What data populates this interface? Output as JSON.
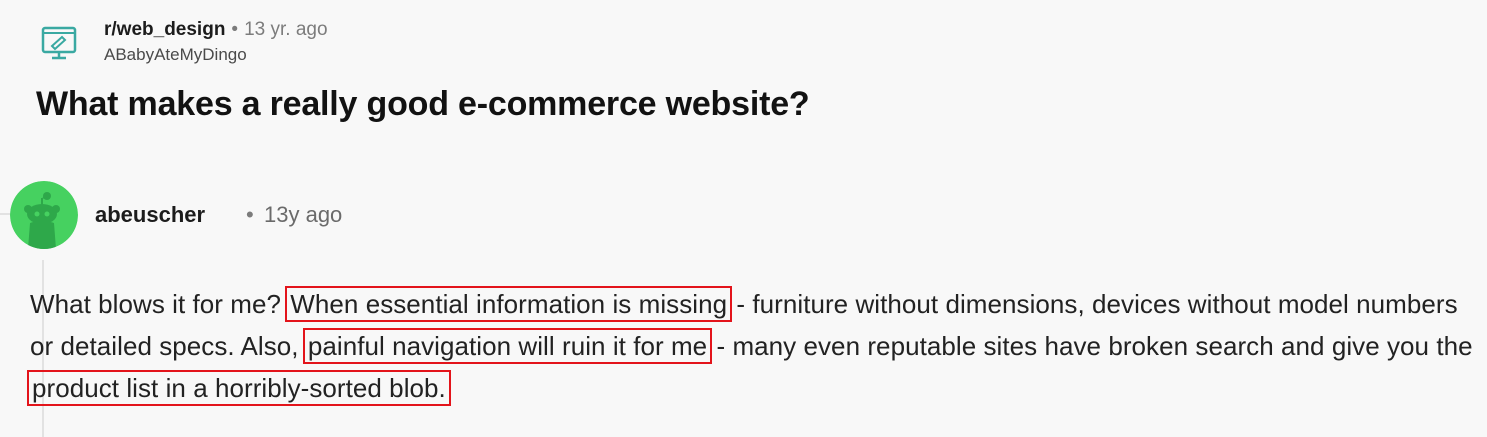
{
  "post": {
    "subreddit": "r/web_design",
    "separator": "•",
    "age": "13 yr. ago",
    "author": "ABabyAteMyDingo",
    "title": "What makes a really good e-commerce website?",
    "subreddit_icon": "computer-screen-icon"
  },
  "comment": {
    "author": "abeuscher",
    "separator": "•",
    "age": "13y ago",
    "avatar": "reddit-snoo-avatar",
    "avatar_color": "#46d160",
    "body": {
      "segment_1": "What blows it for me? ",
      "highlight_1": "When essential information is missing",
      "segment_2": " - furniture without dimensions, devices without model numbers or detailed specs. Also, ",
      "highlight_2": "painful navigation will ruin it for me",
      "segment_3": " - many even reputable sites have broken search and give you the ",
      "highlight_3": "product list in a horribly-sorted blob."
    },
    "highlight_color": "#e3141b"
  }
}
